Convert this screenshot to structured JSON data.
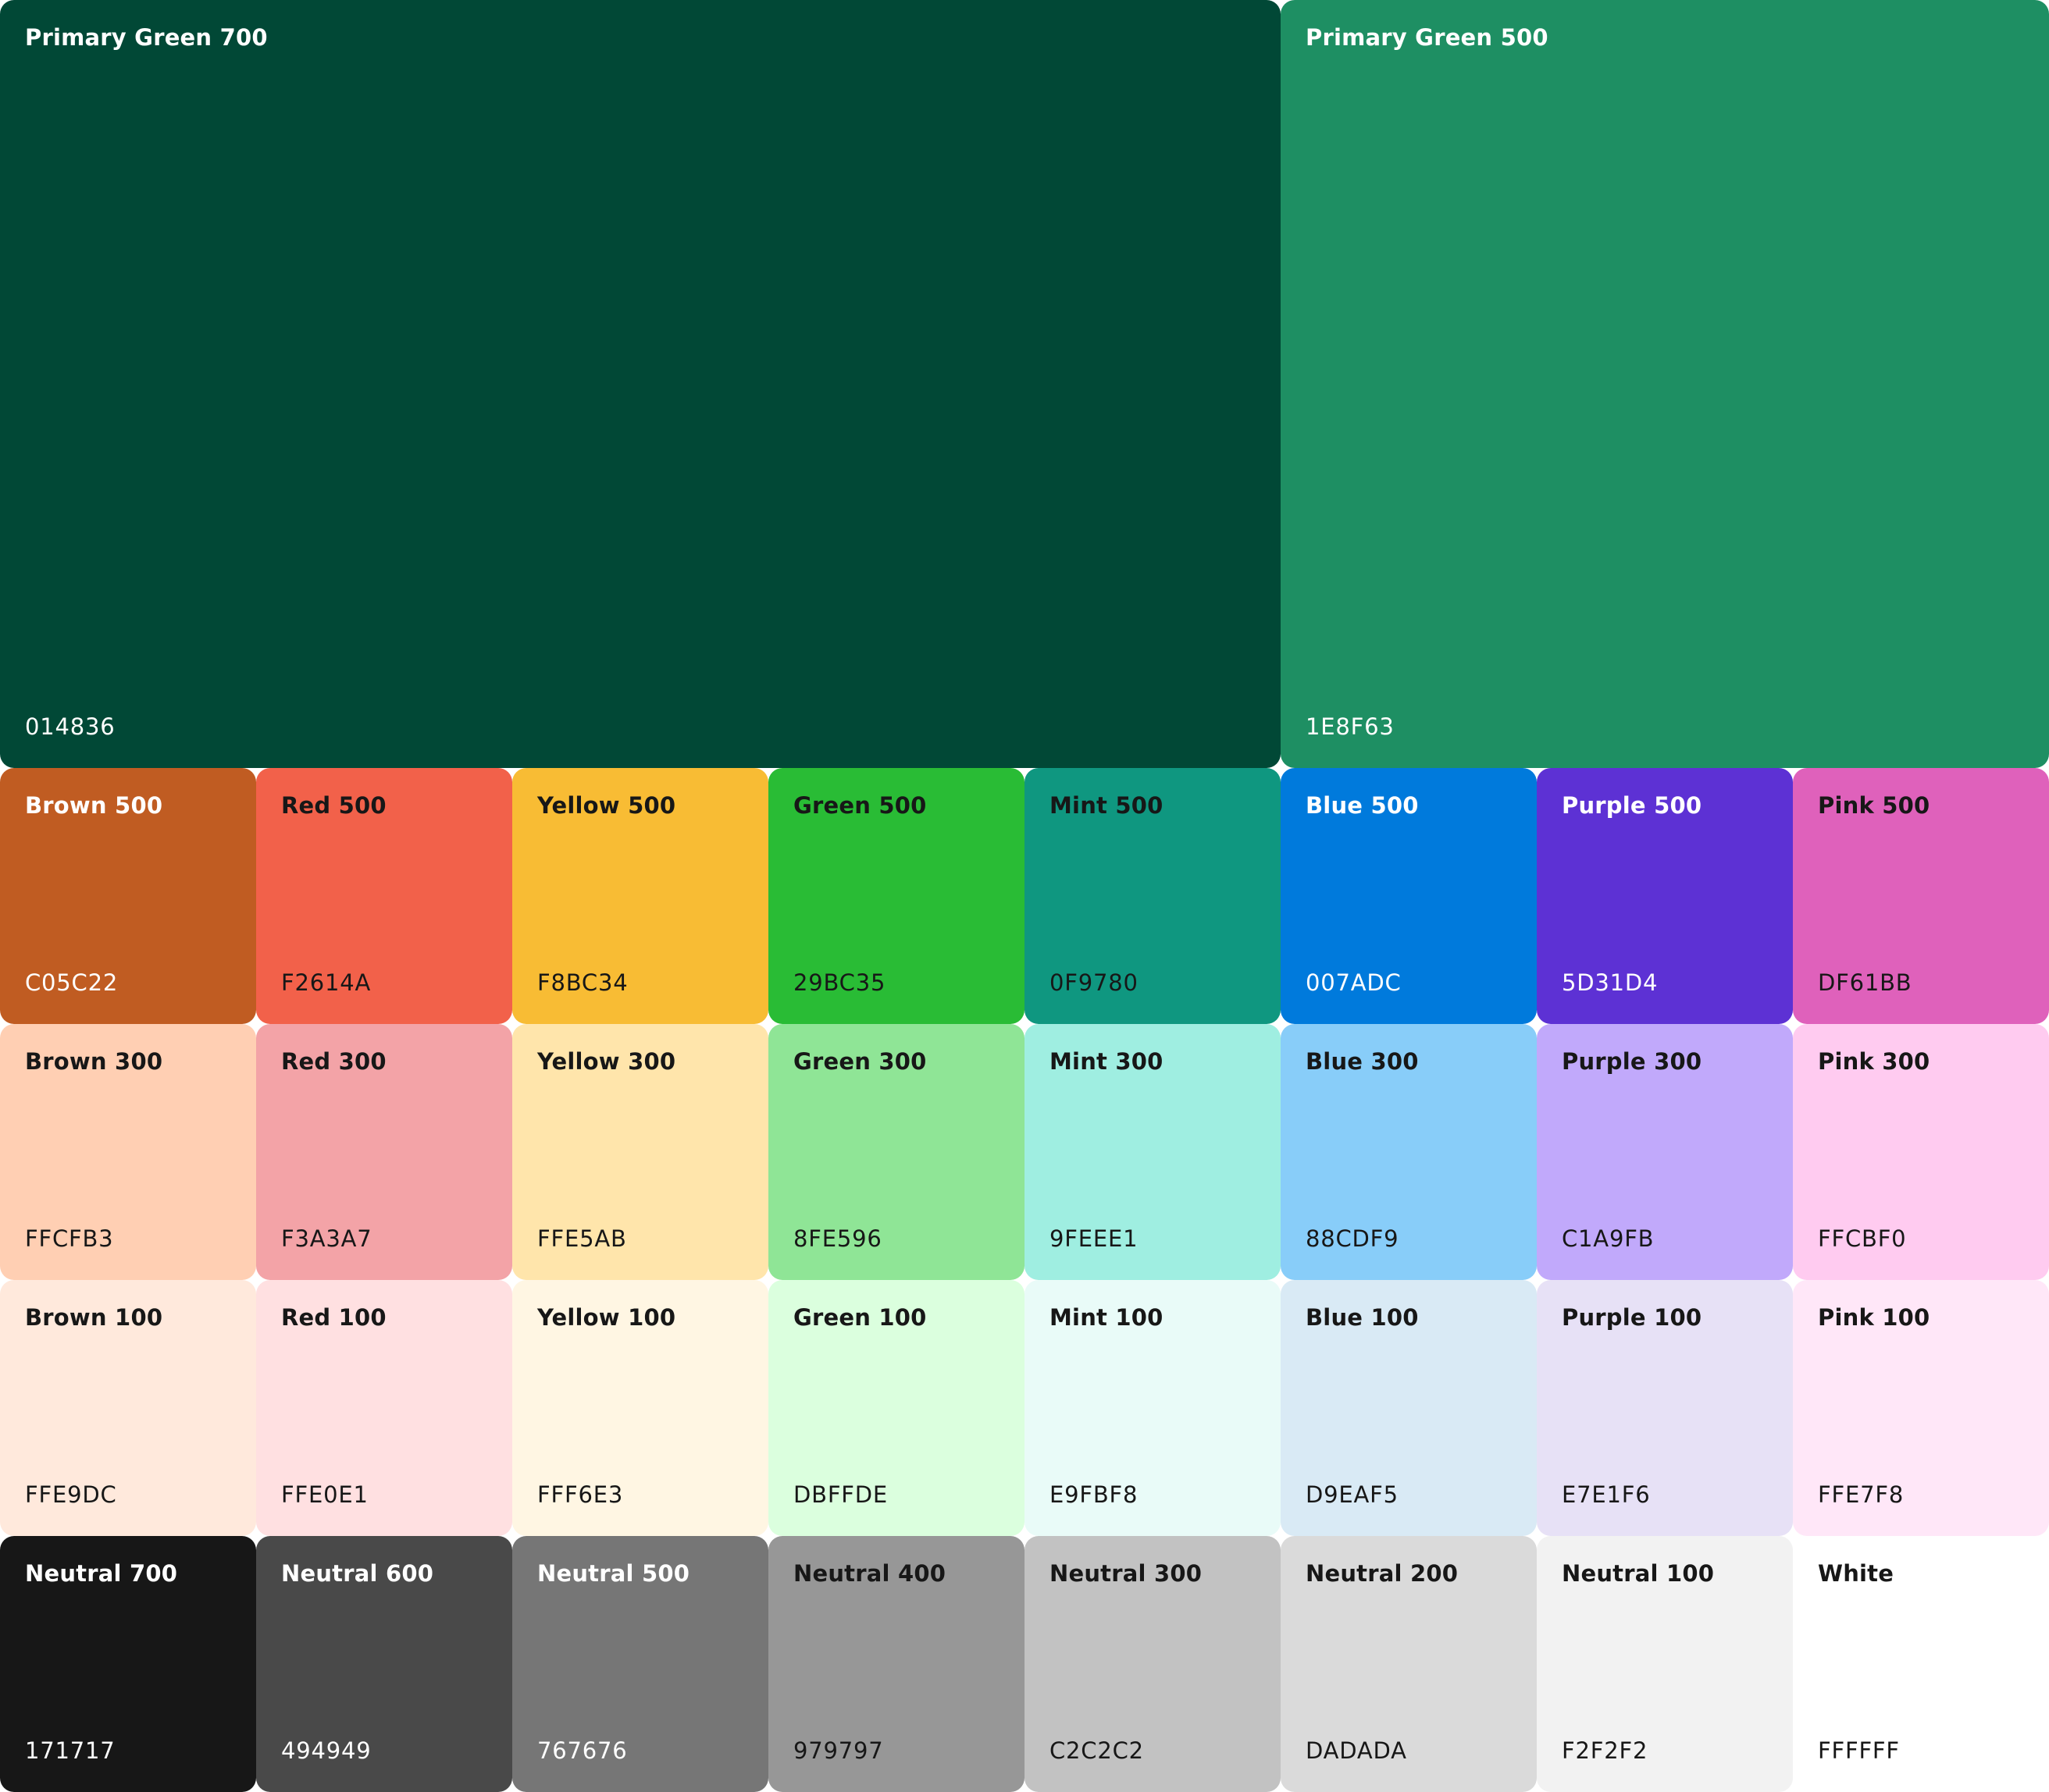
{
  "primary": [
    {
      "name": "Primary Green 700",
      "hex": "014836",
      "color": "#014836",
      "text_color": "#FFFFFF"
    },
    {
      "name": "Primary Green 500",
      "hex": "1E8F63",
      "color": "#1E8F63",
      "text_color": "#FFFFFF"
    }
  ],
  "rows": [
    [
      {
        "name": "Brown 500",
        "hex": "C05C22",
        "color": "#C05C22",
        "text_color": "#FFFFFF"
      },
      {
        "name": "Red 500",
        "hex": "F2614A",
        "color": "#F2614A",
        "text_color": "#171717"
      },
      {
        "name": "Yellow 500",
        "hex": "F8BC34",
        "color": "#F8BC34",
        "text_color": "#171717"
      },
      {
        "name": "Green 500",
        "hex": "29BC35",
        "color": "#29BC35",
        "text_color": "#171717"
      },
      {
        "name": "Mint 500",
        "hex": "0F9780",
        "color": "#0F9780",
        "text_color": "#171717"
      },
      {
        "name": "Blue 500",
        "hex": "007ADC",
        "color": "#007ADC",
        "text_color": "#FFFFFF"
      },
      {
        "name": "Purple 500",
        "hex": "5D31D4",
        "color": "#5D31D4",
        "text_color": "#FFFFFF"
      },
      {
        "name": "Pink 500",
        "hex": "DF61BB",
        "color": "#DF61BB",
        "text_color": "#171717"
      }
    ],
    [
      {
        "name": "Brown 300",
        "hex": "FFCFB3",
        "color": "#FFCFB3",
        "text_color": "#171717"
      },
      {
        "name": "Red 300",
        "hex": "F3A3A7",
        "color": "#F3A3A7",
        "text_color": "#171717"
      },
      {
        "name": "Yellow 300",
        "hex": "FFE5AB",
        "color": "#FFE5AB",
        "text_color": "#171717"
      },
      {
        "name": "Green 300",
        "hex": "8FE596",
        "color": "#8FE596",
        "text_color": "#171717"
      },
      {
        "name": "Mint 300",
        "hex": "9FEEE1",
        "color": "#9FEEE1",
        "text_color": "#171717"
      },
      {
        "name": "Blue 300",
        "hex": "88CDF9",
        "color": "#88CDF9",
        "text_color": "#171717"
      },
      {
        "name": "Purple 300",
        "hex": "C1A9FB",
        "color": "#C1A9FB",
        "text_color": "#171717"
      },
      {
        "name": "Pink 300",
        "hex": "FFCBF0",
        "color": "#FFCBF0",
        "text_color": "#171717"
      }
    ],
    [
      {
        "name": "Brown 100",
        "hex": "FFE9DC",
        "color": "#FFE9DC",
        "text_color": "#171717"
      },
      {
        "name": "Red 100",
        "hex": "FFE0E1",
        "color": "#FFE0E1",
        "text_color": "#171717"
      },
      {
        "name": "Yellow 100",
        "hex": "FFF6E3",
        "color": "#FFF6E3",
        "text_color": "#171717"
      },
      {
        "name": "Green 100",
        "hex": "DBFFDE",
        "color": "#DBFFDE",
        "text_color": "#171717"
      },
      {
        "name": "Mint 100",
        "hex": "E9FBF8",
        "color": "#E9FBF8",
        "text_color": "#171717"
      },
      {
        "name": "Blue 100",
        "hex": "D9EAF5",
        "color": "#D9EAF5",
        "text_color": "#171717"
      },
      {
        "name": "Purple 100",
        "hex": "E7E1F6",
        "color": "#E7E1F6",
        "text_color": "#171717"
      },
      {
        "name": "Pink 100",
        "hex": "FFE7F8",
        "color": "#FFE7F8",
        "text_color": "#171717"
      }
    ],
    [
      {
        "name": "Neutral 700",
        "hex": "171717",
        "color": "#171717",
        "text_color": "#FFFFFF"
      },
      {
        "name": "Neutral 600",
        "hex": "494949",
        "color": "#494949",
        "text_color": "#FFFFFF"
      },
      {
        "name": "Neutral 500",
        "hex": "767676",
        "color": "#767676",
        "text_color": "#FFFFFF"
      },
      {
        "name": "Neutral 400",
        "hex": "979797",
        "color": "#979797",
        "text_color": "#171717"
      },
      {
        "name": "Neutral 300",
        "hex": "C2C2C2",
        "color": "#C2C2C2",
        "text_color": "#171717"
      },
      {
        "name": "Neutral 200",
        "hex": "DADADA",
        "color": "#DADADA",
        "text_color": "#171717"
      },
      {
        "name": "Neutral 100",
        "hex": "F2F2F2",
        "color": "#F2F2F2",
        "text_color": "#171717"
      },
      {
        "name": "White",
        "hex": "FFFFFF",
        "color": "#FFFFFF",
        "text_color": "#171717"
      }
    ]
  ]
}
